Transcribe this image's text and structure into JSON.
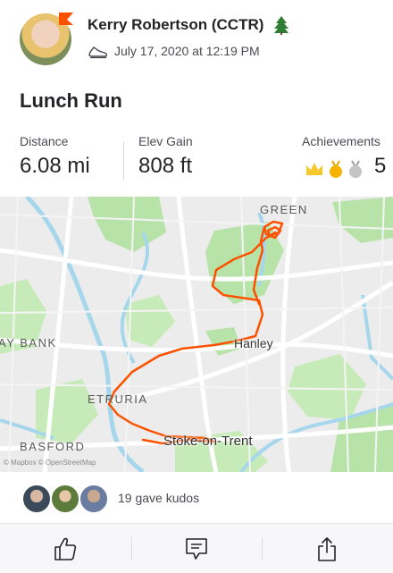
{
  "activity": {
    "athlete_name": "Kerry Robertson (CCTR)",
    "date": "July 17, 2020 at 12:19 PM",
    "title": "Lunch Run"
  },
  "stats": [
    {
      "label": "Distance",
      "value": "6.08 mi"
    },
    {
      "label": "Elev Gain",
      "value": "808 ft"
    },
    {
      "label": "Achievements",
      "value": "5"
    }
  ],
  "achievements": {
    "icons": [
      "crown-icon",
      "gold-medal-icon",
      "silver-medal-icon"
    ],
    "count": "5"
  },
  "map": {
    "labels": {
      "north": "GREEN",
      "west": "AY BANK",
      "etruria": "ETRURIA",
      "basford": "BASFORD",
      "hanley": "Hanley",
      "stoke": "Stoke-on-Trent"
    },
    "credit": "© Mapbox © OpenStreetMap",
    "route_color": "#fc5200"
  },
  "kudos": {
    "text": "19 gave kudos"
  },
  "actions": {
    "kudos": "thumbs-up-icon",
    "comment": "comment-icon",
    "share": "share-icon"
  },
  "colors": {
    "brand": "#fc5200",
    "water": "#a6d6ec",
    "park": "#b8e3a8"
  }
}
